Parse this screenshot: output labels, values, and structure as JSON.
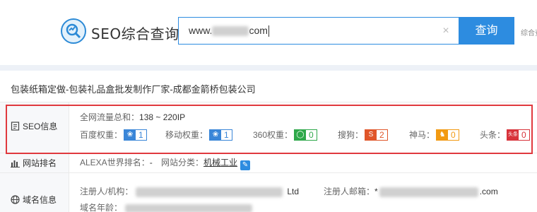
{
  "header": {
    "brand": "SEO综合查询",
    "search_value_prefix": "www.",
    "search_value_suffix": "com",
    "search_button": "查询",
    "extra_text": "综合查"
  },
  "site_title": "包装纸箱定做-包装礼品盒批发制作厂家-成都金箭桥包装公司",
  "seo": {
    "label": "SEO信息",
    "traffic_label": "全网流量总和：",
    "traffic_value": "138 ~ 220IP",
    "metrics": [
      {
        "label": "百度权重：",
        "value": "1",
        "color": "#3a86d8",
        "icon": "paw-icon"
      },
      {
        "label": "移动权重：",
        "value": "1",
        "color": "#3a86d8",
        "icon": "paw-icon"
      },
      {
        "label": "360权重：",
        "value": "0",
        "color": "#2ea84a",
        "icon": "circle-icon"
      },
      {
        "label": "搜狗：",
        "value": "2",
        "color": "#e0562a",
        "icon": "sogou-icon"
      },
      {
        "label": "神马：",
        "value": "0",
        "color": "#f29a12",
        "icon": "horse-icon"
      },
      {
        "label": "头条：",
        "value": "0",
        "color": "#d8323a",
        "icon": "toutiao-icon"
      }
    ]
  },
  "ranking": {
    "label": "网站排名",
    "alexa_label": "ALEXA世界排名：",
    "alexa_value": "-",
    "category_label": "网站分类：",
    "category_value": "机械工业"
  },
  "domain": {
    "label": "域名信息",
    "registrant_label": "注册人/机构：",
    "registrant_suffix": "Ltd",
    "email_label": "注册人邮箱：",
    "email_prefix": "*",
    "email_suffix": ".com",
    "age_label": "域名年龄："
  }
}
